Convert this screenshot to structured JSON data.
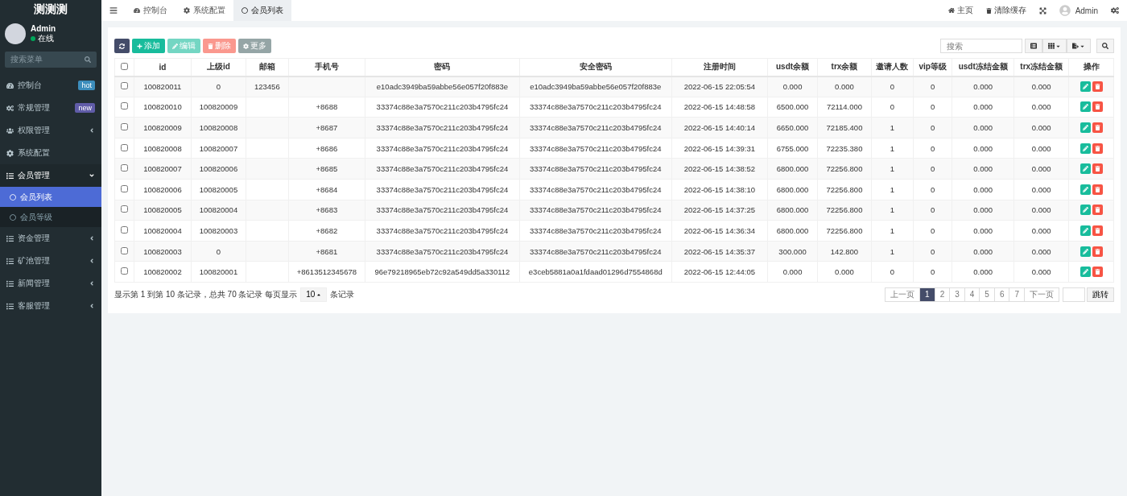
{
  "sidebar": {
    "brand": "测测测",
    "user": {
      "name": "Admin",
      "status": "在线",
      "online": true
    },
    "search": {
      "placeholder": "搜索菜单"
    },
    "items": [
      {
        "kind": "link",
        "label": "控制台",
        "badge": "hot",
        "color": "#3c8dbc",
        "selected": false
      },
      {
        "kind": "link",
        "label": "常规管理",
        "badge": "new",
        "color": "#605ca8",
        "selected": false
      },
      {
        "kind": "group",
        "label": "权限管理",
        "expanded": false,
        "selected": false
      },
      {
        "kind": "link",
        "label": "系统配置",
        "selected": false
      },
      {
        "kind": "group",
        "label": "会员管理",
        "expanded": true,
        "selected": false,
        "children": [
          {
            "label": "会员列表",
            "selected": true
          },
          {
            "label": "会员等级",
            "selected": false
          }
        ]
      },
      {
        "kind": "group",
        "label": "资金管理",
        "expanded": false,
        "selected": false
      },
      {
        "kind": "group",
        "label": "矿池管理",
        "expanded": false,
        "selected": false
      },
      {
        "kind": "group",
        "label": "新闻管理",
        "expanded": false,
        "selected": false
      },
      {
        "kind": "group",
        "label": "客服管理",
        "expanded": false,
        "selected": false
      }
    ]
  },
  "tabs": [
    {
      "label": "控制台",
      "selected": false
    },
    {
      "label": "系统配置",
      "selected": false
    },
    {
      "label": "会员列表",
      "selected": true
    }
  ],
  "topbar": {
    "home": "主页",
    "clear_cache": "清除缓存",
    "user": "Admin"
  },
  "toolbar": {
    "buttons": [
      {
        "kind": "refresh",
        "disabled": false
      },
      {
        "kind": "add",
        "label": "添加",
        "disabled": false
      },
      {
        "kind": "edit",
        "label": "编辑",
        "disabled": true
      },
      {
        "kind": "delete",
        "label": "删除",
        "disabled": true
      },
      {
        "kind": "more",
        "label": "更多",
        "disabled": false
      }
    ],
    "search": {
      "placeholder": "搜索"
    }
  },
  "table": {
    "all_checked": false,
    "columns": [
      "id",
      "上级id",
      "邮箱",
      "手机号",
      "密码",
      "安全密码",
      "注册时间",
      "usdt余额",
      "trx余额",
      "邀请人数",
      "vip等级",
      "usdt冻结金额",
      "trx冻结金额",
      "操作"
    ],
    "rows": [
      {
        "checked": false,
        "cells": [
          "100820011",
          "0",
          "123456",
          "",
          "e10adc3949ba59abbe56e057f20f883e",
          "e10adc3949ba59abbe56e057f20f883e",
          "2022-06-15 22:05:54",
          "0.000",
          "0.000",
          "0",
          "0",
          "0.000",
          "0.000"
        ]
      },
      {
        "checked": false,
        "cells": [
          "100820010",
          "100820009",
          "",
          "+8688",
          "33374c88e3a7570c211c203b4795fc24",
          "33374c88e3a7570c211c203b4795fc24",
          "2022-06-15 14:48:58",
          "6500.000",
          "72114.000",
          "0",
          "0",
          "0.000",
          "0.000"
        ]
      },
      {
        "checked": false,
        "cells": [
          "100820009",
          "100820008",
          "",
          "+8687",
          "33374c88e3a7570c211c203b4795fc24",
          "33374c88e3a7570c211c203b4795fc24",
          "2022-06-15 14:40:14",
          "6650.000",
          "72185.400",
          "1",
          "0",
          "0.000",
          "0.000"
        ]
      },
      {
        "checked": false,
        "cells": [
          "100820008",
          "100820007",
          "",
          "+8686",
          "33374c88e3a7570c211c203b4795fc24",
          "33374c88e3a7570c211c203b4795fc24",
          "2022-06-15 14:39:31",
          "6755.000",
          "72235.380",
          "1",
          "0",
          "0.000",
          "0.000"
        ]
      },
      {
        "checked": false,
        "cells": [
          "100820007",
          "100820006",
          "",
          "+8685",
          "33374c88e3a7570c211c203b4795fc24",
          "33374c88e3a7570c211c203b4795fc24",
          "2022-06-15 14:38:52",
          "6800.000",
          "72256.800",
          "1",
          "0",
          "0.000",
          "0.000"
        ]
      },
      {
        "checked": false,
        "cells": [
          "100820006",
          "100820005",
          "",
          "+8684",
          "33374c88e3a7570c211c203b4795fc24",
          "33374c88e3a7570c211c203b4795fc24",
          "2022-06-15 14:38:10",
          "6800.000",
          "72256.800",
          "1",
          "0",
          "0.000",
          "0.000"
        ]
      },
      {
        "checked": false,
        "cells": [
          "100820005",
          "100820004",
          "",
          "+8683",
          "33374c88e3a7570c211c203b4795fc24",
          "33374c88e3a7570c211c203b4795fc24",
          "2022-06-15 14:37:25",
          "6800.000",
          "72256.800",
          "1",
          "0",
          "0.000",
          "0.000"
        ]
      },
      {
        "checked": false,
        "cells": [
          "100820004",
          "100820003",
          "",
          "+8682",
          "33374c88e3a7570c211c203b4795fc24",
          "33374c88e3a7570c211c203b4795fc24",
          "2022-06-15 14:36:34",
          "6800.000",
          "72256.800",
          "1",
          "0",
          "0.000",
          "0.000"
        ]
      },
      {
        "checked": false,
        "cells": [
          "100820003",
          "0",
          "",
          "+8681",
          "33374c88e3a7570c211c203b4795fc24",
          "33374c88e3a7570c211c203b4795fc24",
          "2022-06-15 14:35:37",
          "300.000",
          "142.800",
          "1",
          "0",
          "0.000",
          "0.000"
        ]
      },
      {
        "checked": false,
        "cells": [
          "100820002",
          "100820001",
          "",
          "+8613512345678",
          "96e79218965eb72c92a549dd5a330112",
          "e3ceb5881a0a1fdaad01296d7554868d",
          "2022-06-15 12:44:05",
          "0.000",
          "0.000",
          "0",
          "0",
          "0.000",
          "0.000"
        ]
      }
    ]
  },
  "footer": {
    "summary": "显示第 1 到第 10 条记录，总共 70 条记录 每页显示",
    "page_size": "10",
    "page_size_suffix": "条记录"
  },
  "pagination": {
    "prev": "上一页",
    "next": "下一页",
    "jump": "跳转",
    "pages": [
      {
        "label": "1",
        "selected": true
      },
      {
        "label": "2",
        "selected": false
      },
      {
        "label": "3",
        "selected": false
      },
      {
        "label": "4",
        "selected": false
      },
      {
        "label": "5",
        "selected": false
      },
      {
        "label": "6",
        "selected": false
      },
      {
        "label": "7",
        "selected": false
      }
    ]
  }
}
